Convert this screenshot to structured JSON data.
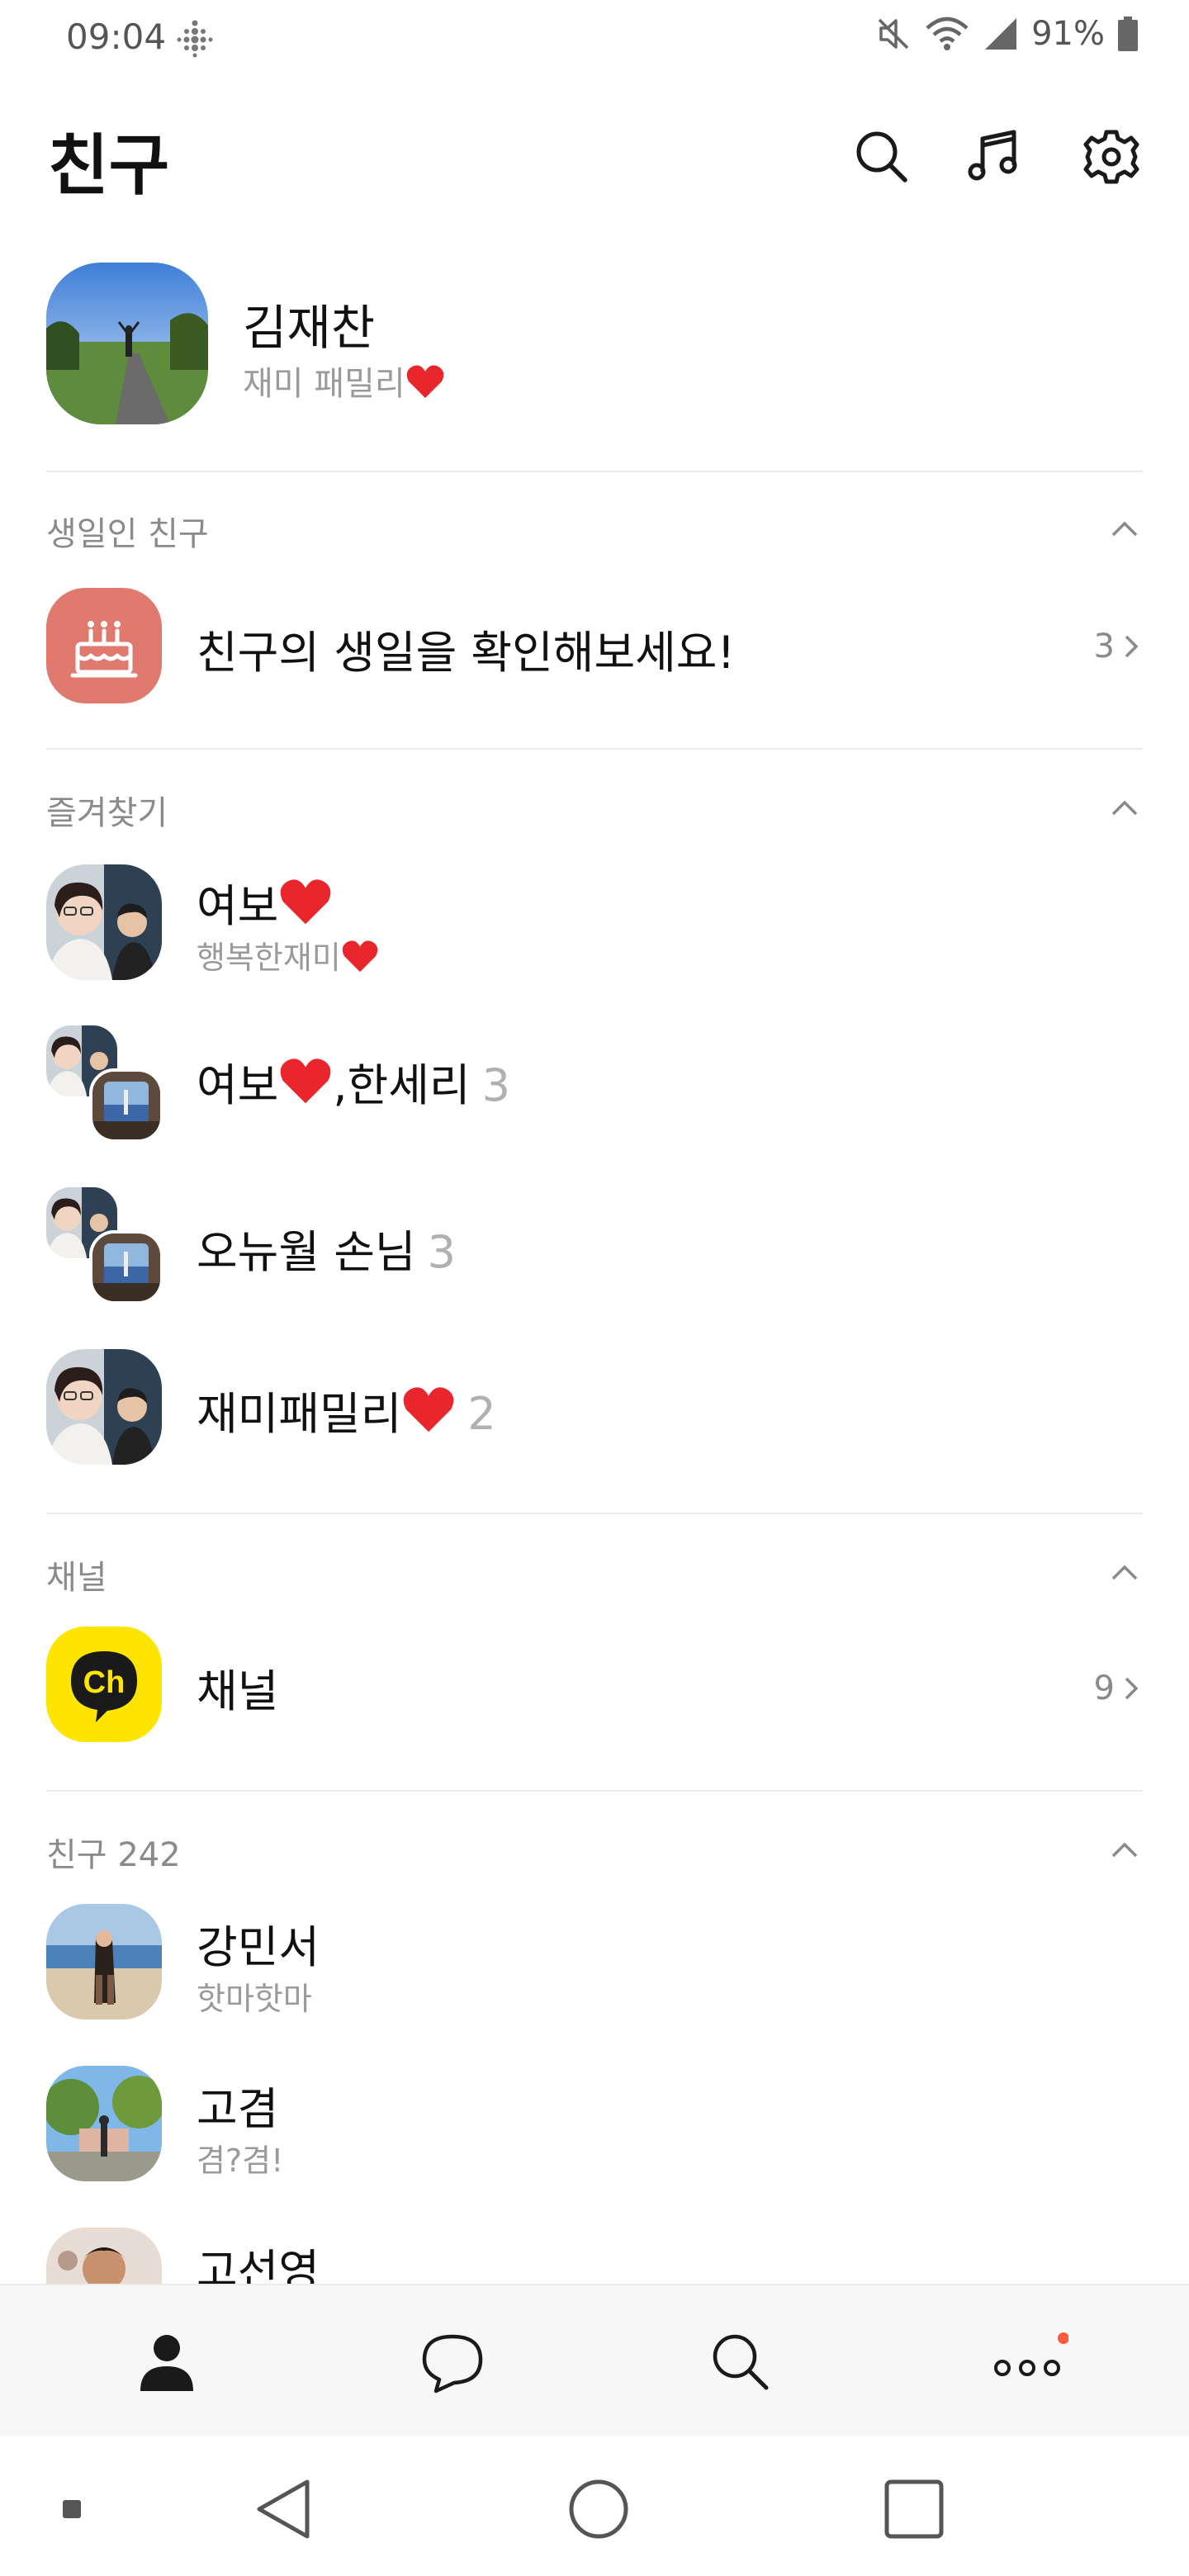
{
  "status_bar": {
    "time": "09:04",
    "battery": "91%"
  },
  "header": {
    "title": "친구"
  },
  "profile": {
    "name": "김재찬",
    "status": "재미 패밀리"
  },
  "birthday": {
    "section_label": "생일인 친구",
    "text": "친구의 생일을 확인해보세요!",
    "count": "3"
  },
  "favorites": {
    "section_label": "즐겨찾기",
    "items": [
      {
        "name": "여보",
        "sub": "행복한재미",
        "count": ""
      },
      {
        "name": "여보",
        "name_suffix": ",한세리",
        "count": "3"
      },
      {
        "name": "오뉴월 손님",
        "count": "3"
      },
      {
        "name": "재미패밀리",
        "count": "2"
      }
    ]
  },
  "channel": {
    "section_label": "채널",
    "name": "채널",
    "count": "9",
    "logo_text": "Ch"
  },
  "friends": {
    "section_label": "친구 242",
    "items": [
      {
        "name": "강민서",
        "sub": "핫마핫마"
      },
      {
        "name": "고겸",
        "sub": "겸?겸!"
      },
      {
        "name": "고선영",
        "sub": ""
      }
    ]
  },
  "colors": {
    "accent_heart": "#e8262b",
    "birthday_bg": "#e07a6f",
    "channel_bg": "#fee500",
    "notify_dot": "#ff5a3c"
  },
  "icons": {
    "header": [
      "search-icon",
      "music-icon",
      "gear-icon"
    ],
    "bottom_nav": [
      "person-icon",
      "chat-icon",
      "search-icon",
      "more-icon"
    ],
    "system_nav": [
      "back-icon",
      "home-icon",
      "recents-icon"
    ]
  }
}
